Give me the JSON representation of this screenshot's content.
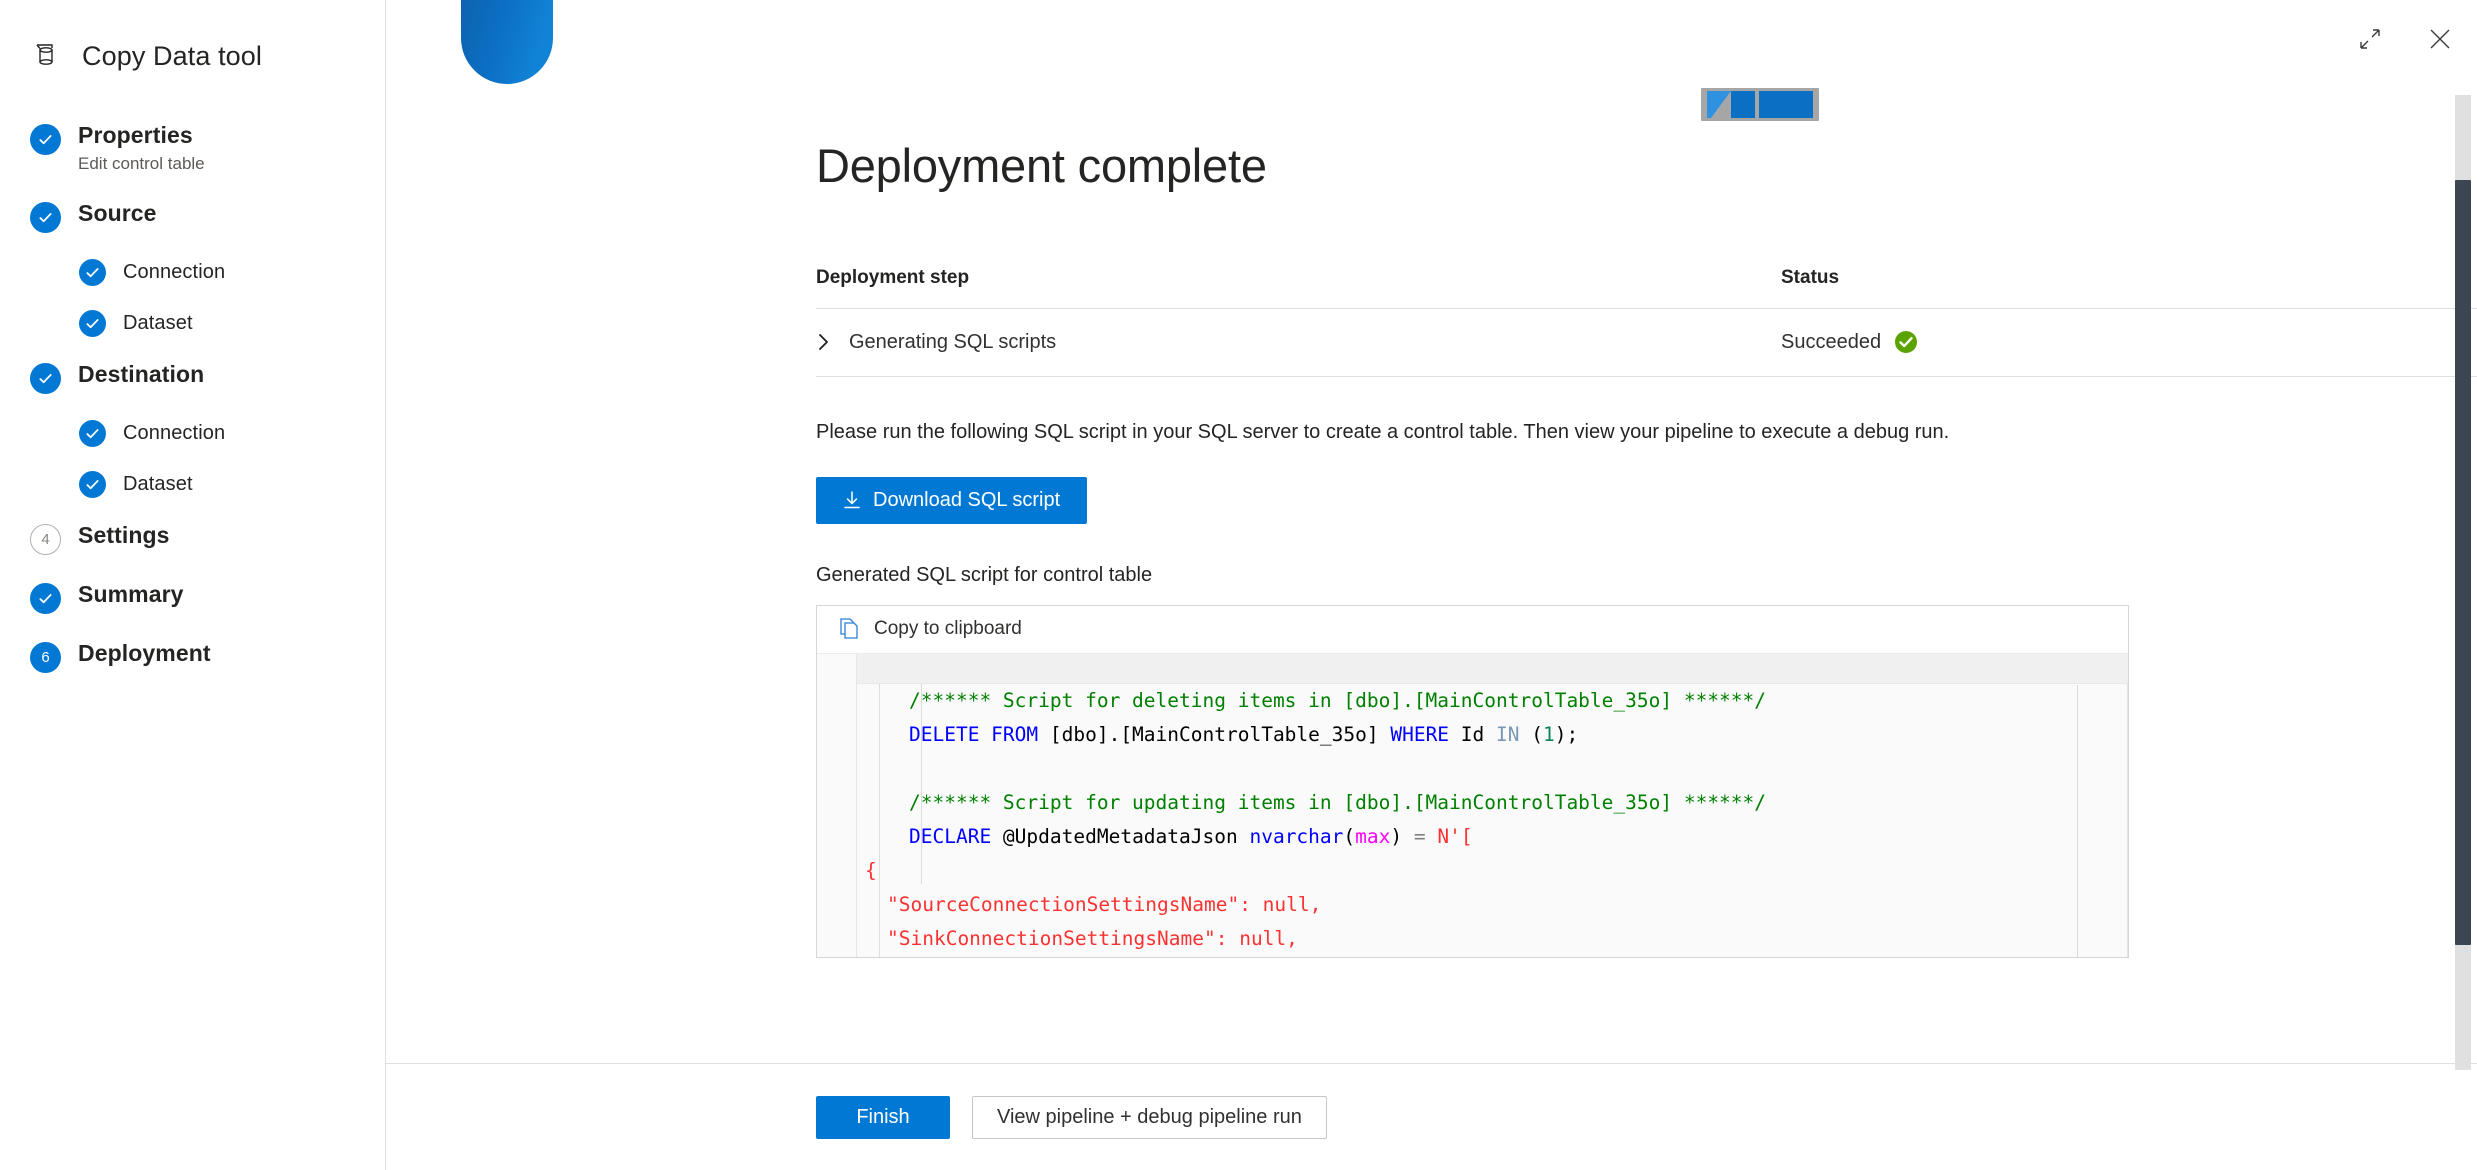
{
  "app": {
    "title": "Copy Data tool",
    "brand_icon": "database-icon"
  },
  "window_controls": {
    "expand": "expand-icon",
    "close": "close-icon"
  },
  "sidebar": {
    "items": [
      {
        "label": "Properties",
        "sublabel": "Edit control table",
        "state": "done",
        "marker": "check",
        "level": 0
      },
      {
        "label": "Source",
        "sublabel": "",
        "state": "done",
        "marker": "check",
        "level": 0
      },
      {
        "label": "Connection",
        "sublabel": "",
        "state": "done",
        "marker": "check",
        "level": 1
      },
      {
        "label": "Dataset",
        "sublabel": "",
        "state": "done",
        "marker": "check",
        "level": 1
      },
      {
        "label": "Destination",
        "sublabel": "",
        "state": "done",
        "marker": "check",
        "level": 0
      },
      {
        "label": "Connection",
        "sublabel": "",
        "state": "done",
        "marker": "check",
        "level": 1
      },
      {
        "label": "Dataset",
        "sublabel": "",
        "state": "done",
        "marker": "check",
        "level": 1
      },
      {
        "label": "Settings",
        "sublabel": "",
        "state": "pending",
        "marker": "4",
        "level": 0
      },
      {
        "label": "Summary",
        "sublabel": "",
        "state": "done",
        "marker": "check",
        "level": 0
      },
      {
        "label": "Deployment",
        "sublabel": "",
        "state": "current",
        "marker": "6",
        "level": 0
      }
    ]
  },
  "main": {
    "page_title": "Deployment complete",
    "table": {
      "headers": {
        "step": "Deployment step",
        "status": "Status"
      },
      "rows": [
        {
          "step": "Generating SQL scripts",
          "status": "Succeeded",
          "status_icon": "check-circle-green-icon",
          "expand_icon": "chevron-right-icon"
        }
      ]
    },
    "instruction": "Please run the following SQL script in your SQL server to create a control table. Then view your pipeline to execute a debug run.",
    "download_button": {
      "label": "Download SQL script",
      "icon": "download-icon"
    },
    "script_section_label": "Generated SQL script for control table",
    "editor": {
      "copy_label": "Copy to clipboard",
      "copy_icon": "copy-pages-icon",
      "lines": [
        {
          "indent": 0,
          "tokens": [
            {
              "t": "/****** Script for deleting items in [dbo].[MainControlTable_35o] ******/",
              "c": "tok-cmt"
            }
          ]
        },
        {
          "indent": 0,
          "tokens": [
            {
              "t": "DELETE FROM",
              "c": "tok-kw"
            },
            {
              "t": " [dbo].[MainControlTable_35o] ",
              "c": "tok-pln"
            },
            {
              "t": "WHERE",
              "c": "tok-kw"
            },
            {
              "t": " Id ",
              "c": "tok-pln"
            },
            {
              "t": "IN",
              "c": "tok-kw2"
            },
            {
              "t": " (",
              "c": "tok-pln"
            },
            {
              "t": "1",
              "c": "tok-num"
            },
            {
              "t": ");",
              "c": "tok-pln"
            }
          ]
        },
        {
          "indent": 0,
          "tokens": [
            {
              "t": "",
              "c": "tok-pln"
            }
          ]
        },
        {
          "indent": 0,
          "tokens": [
            {
              "t": "/****** Script for updating items in [dbo].[MainControlTable_35o] ******/",
              "c": "tok-cmt"
            }
          ]
        },
        {
          "indent": 0,
          "tokens": [
            {
              "t": "DECLARE",
              "c": "tok-kw"
            },
            {
              "t": " @UpdatedMetadataJson ",
              "c": "tok-pln"
            },
            {
              "t": "nvarchar",
              "c": "tok-kw"
            },
            {
              "t": "(",
              "c": "tok-pln"
            },
            {
              "t": "max",
              "c": "tok-fn"
            },
            {
              "t": ") ",
              "c": "tok-pln"
            },
            {
              "t": "=",
              "c": "tok-op"
            },
            {
              "t": " N'[",
              "c": "tok-str"
            }
          ]
        },
        {
          "indent": -1,
          "tokens": [
            {
              "t": "{",
              "c": "tok-str"
            }
          ]
        },
        {
          "indent": 1,
          "tokens": [
            {
              "t": "\"SourceConnectionSettingsName\": null,",
              "c": "tok-str"
            }
          ]
        },
        {
          "indent": 1,
          "tokens": [
            {
              "t": "\"SinkConnectionSettingsName\": null,",
              "c": "tok-str"
            }
          ]
        }
      ]
    }
  },
  "footer": {
    "finish_label": "Finish",
    "view_pipeline_label": "View pipeline + debug pipeline run"
  },
  "colors": {
    "accent": "#0078d4",
    "success": "#5ba300",
    "scrollbar_thumb": "#3b4652",
    "text": "#252423"
  }
}
